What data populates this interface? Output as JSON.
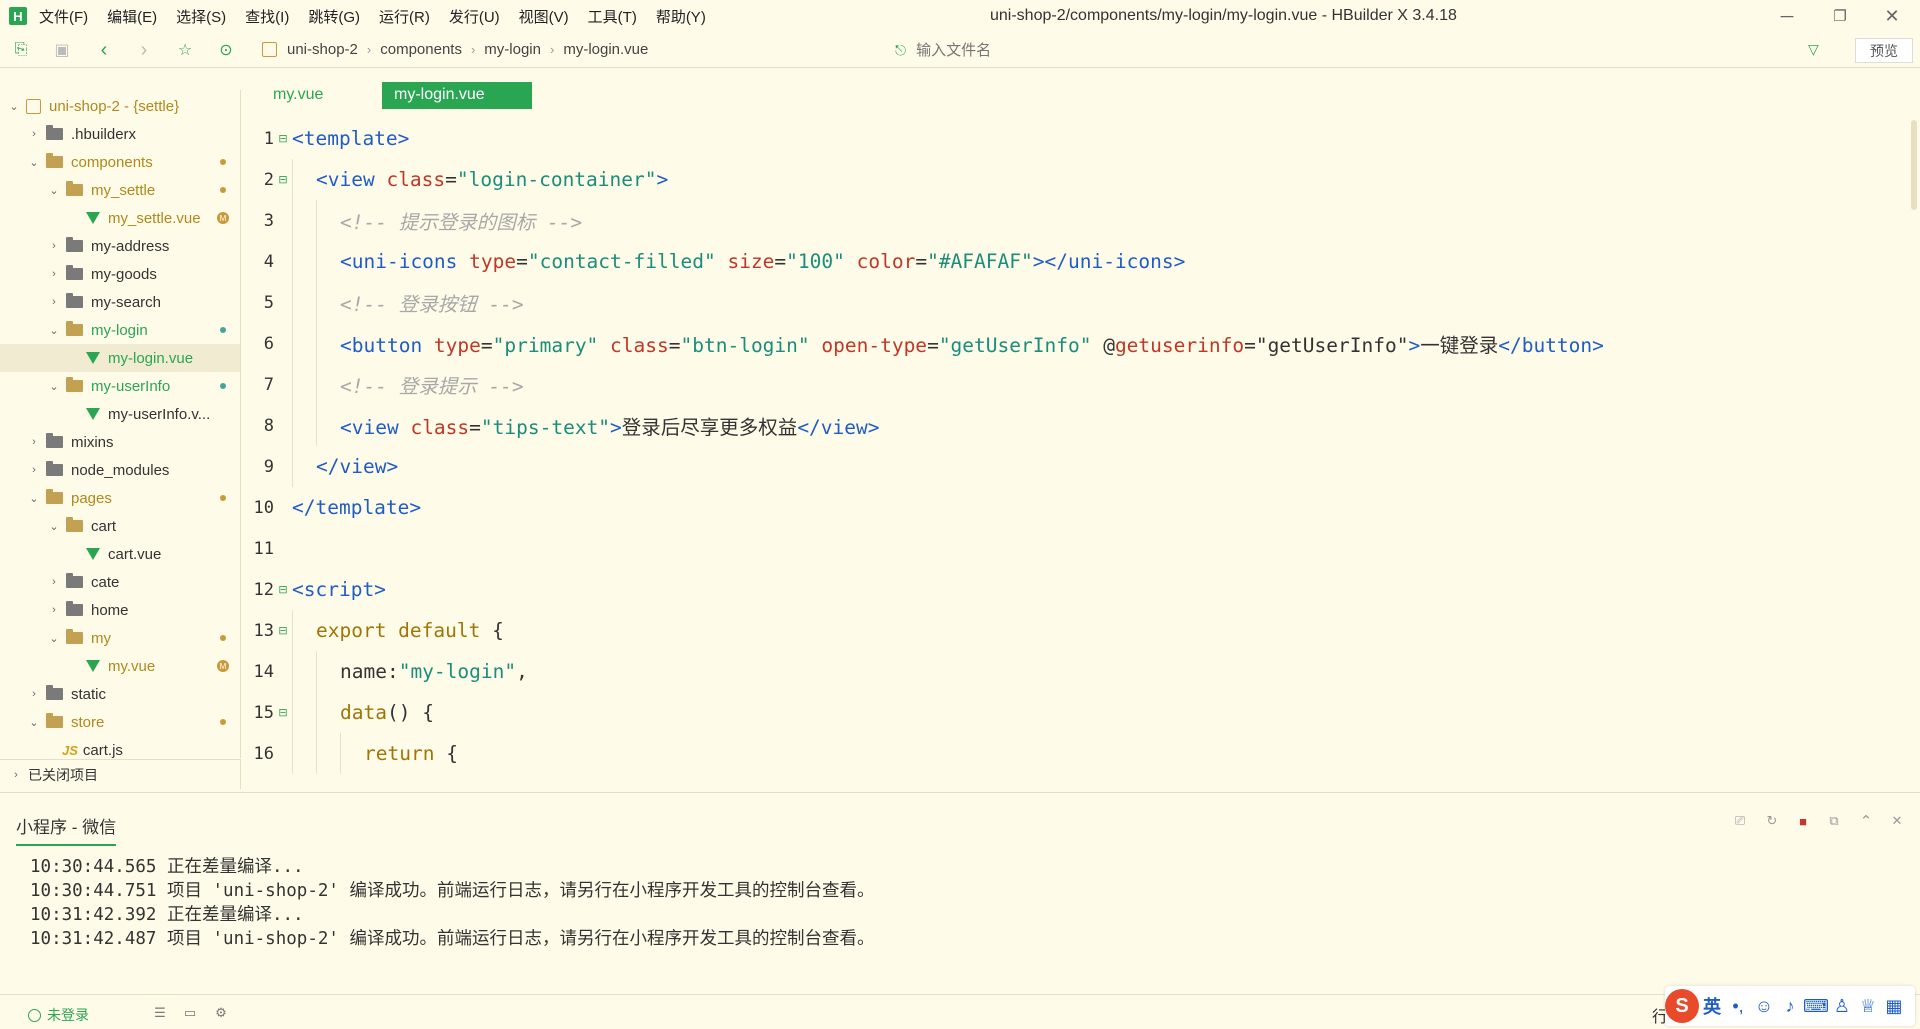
{
  "colors": {
    "accent": "#2aa653",
    "background": "#fffbe9",
    "modified": "#c89a3c",
    "tag": "#1f5dc5",
    "attr": "#c03727",
    "string": "#1a8d7b",
    "comment": "#a8a8a8"
  },
  "app": {
    "logo": "H",
    "window_title": "uni-shop-2/components/my-login/my-login.vue - HBuilder X 3.4.18"
  },
  "menu": [
    {
      "label": "文件(F)"
    },
    {
      "label": "编辑(E)"
    },
    {
      "label": "选择(S)"
    },
    {
      "label": "查找(I)"
    },
    {
      "label": "跳转(G)"
    },
    {
      "label": "运行(R)"
    },
    {
      "label": "发行(U)"
    },
    {
      "label": "视图(V)"
    },
    {
      "label": "工具(T)"
    },
    {
      "label": "帮助(Y)"
    }
  ],
  "window_controls": {
    "minimize": "─",
    "restore": "❐",
    "close": "✕"
  },
  "toolbar": {
    "icons": [
      "new-file-icon",
      "save-icon",
      "back-icon",
      "forward-icon",
      "star-icon",
      "run-icon"
    ],
    "breadcrumb": [
      "uni-shop-2",
      "components",
      "my-login",
      "my-login.vue"
    ],
    "file_search_placeholder": "输入文件名",
    "preview_label": "预览"
  },
  "sidebar": {
    "items": [
      {
        "label": "uni-shop-2 - {settle}",
        "type": "project",
        "open": true,
        "depth": 0,
        "state": "modified"
      },
      {
        "label": ".hbuilderx",
        "type": "folder",
        "open": false,
        "depth": 1
      },
      {
        "label": "components",
        "type": "folder",
        "open": true,
        "depth": 1,
        "state": "modified",
        "dot": "modified"
      },
      {
        "label": "my_settle",
        "type": "folder",
        "open": true,
        "depth": 2,
        "state": "modified",
        "dot": "modified"
      },
      {
        "label": "my_settle.vue",
        "type": "vue",
        "depth": 3,
        "state": "modified",
        "badge": "M"
      },
      {
        "label": "my-address",
        "type": "folder",
        "open": false,
        "depth": 2
      },
      {
        "label": "my-goods",
        "type": "folder",
        "open": false,
        "depth": 2
      },
      {
        "label": "my-search",
        "type": "folder",
        "open": false,
        "depth": 2
      },
      {
        "label": "my-login",
        "type": "folder",
        "open": true,
        "depth": 2,
        "state": "highlight",
        "dot": "new"
      },
      {
        "label": "my-login.vue",
        "type": "vue",
        "depth": 3,
        "state": "highlight",
        "selected": true
      },
      {
        "label": "my-userInfo",
        "type": "folder",
        "open": true,
        "depth": 2,
        "state": "highlight",
        "dot": "new"
      },
      {
        "label": "my-userInfo.v...",
        "type": "vue",
        "depth": 3
      },
      {
        "label": "mixins",
        "type": "folder",
        "open": false,
        "depth": 1
      },
      {
        "label": "node_modules",
        "type": "folder",
        "open": false,
        "depth": 1
      },
      {
        "label": "pages",
        "type": "folder",
        "open": true,
        "depth": 1,
        "state": "modified",
        "dot": "modified"
      },
      {
        "label": "cart",
        "type": "folder",
        "open": true,
        "depth": 2
      },
      {
        "label": "cart.vue",
        "type": "vue",
        "depth": 3
      },
      {
        "label": "cate",
        "type": "folder",
        "open": false,
        "depth": 2
      },
      {
        "label": "home",
        "type": "folder",
        "open": false,
        "depth": 2
      },
      {
        "label": "my",
        "type": "folder",
        "open": true,
        "depth": 2,
        "state": "modified",
        "dot": "modified"
      },
      {
        "label": "my.vue",
        "type": "vue",
        "depth": 3,
        "state": "modified",
        "badge": "M"
      },
      {
        "label": "static",
        "type": "folder",
        "open": false,
        "depth": 1
      },
      {
        "label": "store",
        "type": "folder",
        "open": true,
        "depth": 1,
        "state": "modified",
        "dot": "modified"
      },
      {
        "label": "cart.js",
        "type": "js",
        "depth": 2
      }
    ],
    "closed_projects_label": "已关闭项目"
  },
  "editor_tabs": [
    {
      "label": "my.vue",
      "active": false
    },
    {
      "label": "my-login.vue",
      "active": true
    }
  ],
  "code_lines": [
    {
      "n": "1",
      "fold": "⊟",
      "indent": 0,
      "tokens": [
        [
          "tag",
          "<template>"
        ]
      ]
    },
    {
      "n": "2",
      "fold": "⊟",
      "indent": 1,
      "tokens": [
        [
          "tag",
          "<view "
        ],
        [
          "attr",
          "class"
        ],
        [
          "plain",
          "="
        ],
        [
          "str",
          "\"login-container\""
        ],
        [
          "tag",
          ">"
        ]
      ]
    },
    {
      "n": "3",
      "fold": "",
      "indent": 2,
      "tokens": [
        [
          "com",
          "<!-- 提示登录的图标 -->"
        ]
      ]
    },
    {
      "n": "4",
      "fold": "",
      "indent": 2,
      "tokens": [
        [
          "tag",
          "<uni-icons "
        ],
        [
          "attr",
          "type"
        ],
        [
          "plain",
          "="
        ],
        [
          "str",
          "\"contact-filled\" "
        ],
        [
          "attr",
          "size"
        ],
        [
          "plain",
          "="
        ],
        [
          "str",
          "\"100\" "
        ],
        [
          "attr",
          "color"
        ],
        [
          "plain",
          "="
        ],
        [
          "str",
          "\"#AFAFAF\""
        ],
        [
          "tag",
          "></uni-icons>"
        ]
      ]
    },
    {
      "n": "5",
      "fold": "",
      "indent": 2,
      "tokens": [
        [
          "com",
          "<!-- 登录按钮 -->"
        ]
      ]
    },
    {
      "n": "6",
      "fold": "",
      "indent": 2,
      "tokens": [
        [
          "tag",
          "<button "
        ],
        [
          "attr",
          "type"
        ],
        [
          "plain",
          "="
        ],
        [
          "str",
          "\"primary\" "
        ],
        [
          "attr",
          "class"
        ],
        [
          "plain",
          "="
        ],
        [
          "str",
          "\"btn-login\" "
        ],
        [
          "attr",
          "open-type"
        ],
        [
          "plain",
          "="
        ],
        [
          "str",
          "\"getUserInfo\" "
        ],
        [
          "plain",
          "@"
        ],
        [
          "attr",
          "getuserinfo"
        ],
        [
          "plain",
          "="
        ],
        [
          "plain",
          "\"getUserInfo\""
        ],
        [
          "tag",
          ">"
        ],
        [
          "txt",
          "一键登录"
        ],
        [
          "tag",
          "</button>"
        ]
      ]
    },
    {
      "n": "7",
      "fold": "",
      "indent": 2,
      "tokens": [
        [
          "com",
          "<!-- 登录提示 -->"
        ]
      ]
    },
    {
      "n": "8",
      "fold": "",
      "indent": 2,
      "tokens": [
        [
          "tag",
          "<view "
        ],
        [
          "attr",
          "class"
        ],
        [
          "plain",
          "="
        ],
        [
          "str",
          "\"tips-text\""
        ],
        [
          "tag",
          ">"
        ],
        [
          "txt",
          "登录后尽享更多权益"
        ],
        [
          "tag",
          "</view>"
        ]
      ]
    },
    {
      "n": "9",
      "fold": "",
      "indent": 1,
      "tokens": [
        [
          "tag",
          "</view>"
        ]
      ]
    },
    {
      "n": "10",
      "fold": "",
      "indent": 0,
      "tokens": [
        [
          "tag",
          "</template>"
        ]
      ]
    },
    {
      "n": "11",
      "fold": "",
      "indent": 0,
      "tokens": []
    },
    {
      "n": "12",
      "fold": "⊟",
      "indent": 0,
      "tokens": [
        [
          "tag",
          "<script>"
        ]
      ]
    },
    {
      "n": "13",
      "fold": "⊟",
      "indent": 1,
      "tokens": [
        [
          "kw",
          "export default "
        ],
        [
          "plain",
          "{"
        ]
      ]
    },
    {
      "n": "14",
      "fold": "",
      "indent": 2,
      "tokens": [
        [
          "plain",
          "name:"
        ],
        [
          "str",
          "\"my-login\""
        ],
        [
          "plain",
          ","
        ]
      ]
    },
    {
      "n": "15",
      "fold": "⊟",
      "indent": 2,
      "tokens": [
        [
          "kw",
          "data"
        ],
        [
          "plain",
          "() {"
        ]
      ]
    },
    {
      "n": "16",
      "fold": "",
      "indent": 3,
      "tokens": [
        [
          "kw",
          "return "
        ],
        [
          "plain",
          "{"
        ]
      ]
    }
  ],
  "console": {
    "tab_label": "小程序 - 微信",
    "buttons": [
      "clear-icon",
      "restart-icon",
      "stop-icon",
      "open-external-icon",
      "collapse-icon",
      "close-panel-icon"
    ],
    "logs": [
      "10:30:44.565 正在差量编译...",
      "10:30:44.751 项目 'uni-shop-2' 编译成功。前端运行日志，请另行在小程序开发工具的控制台查看。",
      "10:31:42.392 正在差量编译...",
      "10:31:42.487 项目 'uni-shop-2' 编译成功。前端运行日志，请另行在小程序开发工具的控制台查看。"
    ]
  },
  "statusbar": {
    "login_label": "未登录",
    "row_label": "行",
    "ime": {
      "logo": "S",
      "lang": "英",
      "items": [
        "•,",
        "☺",
        "🎤",
        "⌨",
        "👤",
        "👕",
        "▦"
      ]
    }
  }
}
